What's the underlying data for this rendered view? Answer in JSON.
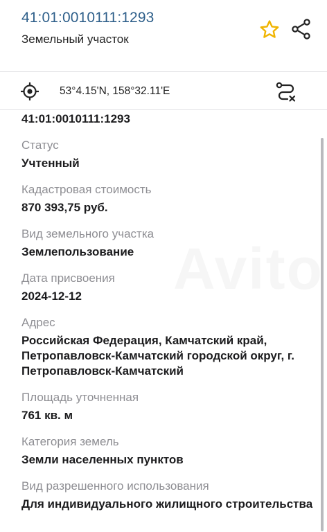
{
  "header": {
    "cadastral_number": "41:01:0010111:1293",
    "object_type": "Земельный участок",
    "icons": {
      "favorite": "star-icon",
      "share": "share-icon"
    },
    "colors": {
      "title": "#2e5f8a",
      "star": "#f0b400"
    }
  },
  "location": {
    "coordinates": "53°4.15'N, 158°32.11'E",
    "icons": {
      "locate": "crosshair-icon",
      "route": "route-icon"
    }
  },
  "details": {
    "number": "41:01:0010111:1293",
    "fields": [
      {
        "label": "Статус",
        "value": "Учтенный"
      },
      {
        "label": "Кадастровая стоимость",
        "value": "870 393,75 руб."
      },
      {
        "label": "Вид земельного участка",
        "value": "Землепользование"
      },
      {
        "label": "Дата присвоения",
        "value": "2024-12-12"
      },
      {
        "label": "Адрес",
        "value": "Российская Федерация, Камчатский край, Петропавловск-Камчатский городской округ, г. Петропавловск-Камчатский"
      },
      {
        "label": "Площадь уточненная",
        "value": "761 кв. м"
      },
      {
        "label": "Категория земель",
        "value": "Земли населенных пунктов"
      },
      {
        "label": "Вид разрешенного использования",
        "value": "Для индивидуального жилищного строительства"
      }
    ]
  },
  "watermark": "Avito"
}
